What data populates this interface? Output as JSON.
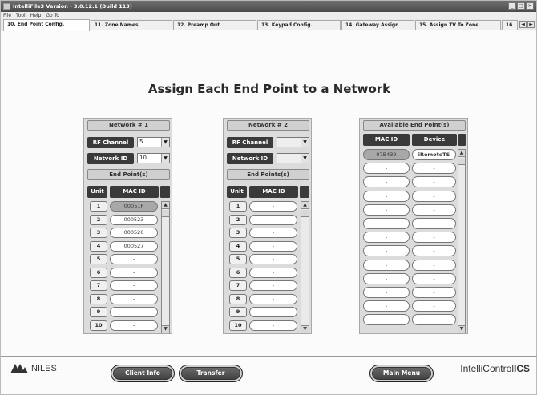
{
  "window": {
    "title": "IntelliFile3 Version - 3.0.12.1 (Build 113)",
    "controls": [
      "_",
      "□",
      "×"
    ]
  },
  "menu": [
    "File",
    "Tool",
    "Help",
    "Go To"
  ],
  "tabs": [
    {
      "label": "10. End Point Config.",
      "active": true
    },
    {
      "label": "11. Zone Names"
    },
    {
      "label": "12. Preamp Out"
    },
    {
      "label": "13. Keypad Config."
    },
    {
      "label": "14. Gateway Assign"
    },
    {
      "label": "15. Assign TV To Zone"
    },
    {
      "label": "16"
    }
  ],
  "tab_arrows": [
    "◄",
    "►"
  ],
  "page_title": "Assign Each End Point to a Network",
  "network1": {
    "title": "Network # 1",
    "rf_label": "RF Channel",
    "rf_value": "5",
    "netid_label": "Netvork ID",
    "netid_value": "10",
    "endpoints_label": "End Point(s)",
    "col_unit": "Unit",
    "col_mac": "MAC ID",
    "rows": [
      {
        "unit": "1",
        "mac": "00051F"
      },
      {
        "unit": "2",
        "mac": "000523"
      },
      {
        "unit": "3",
        "mac": "000526"
      },
      {
        "unit": "4",
        "mac": "000527"
      },
      {
        "unit": "5",
        "mac": "-"
      },
      {
        "unit": "6",
        "mac": "-"
      },
      {
        "unit": "7",
        "mac": "-"
      },
      {
        "unit": "8",
        "mac": "-"
      },
      {
        "unit": "9",
        "mac": "-"
      },
      {
        "unit": "10",
        "mac": "-"
      }
    ]
  },
  "network2": {
    "title": "Network # 2",
    "rf_label": "RF Channel",
    "rf_value": "",
    "netid_label": "Network ID",
    "netid_value": "",
    "endpoints_label": "End Points(s)",
    "col_unit": "Unit",
    "col_mac": "MAC ID",
    "rows": [
      {
        "unit": "1",
        "mac": "-"
      },
      {
        "unit": "2",
        "mac": "-"
      },
      {
        "unit": "3",
        "mac": "-"
      },
      {
        "unit": "4",
        "mac": "-"
      },
      {
        "unit": "5",
        "mac": "-"
      },
      {
        "unit": "6",
        "mac": "-"
      },
      {
        "unit": "7",
        "mac": "-"
      },
      {
        "unit": "8",
        "mac": "-"
      },
      {
        "unit": "9",
        "mac": "-"
      },
      {
        "unit": "10",
        "mac": "-"
      }
    ]
  },
  "available": {
    "title": "Available End Point(s)",
    "col_mac": "MAC ID",
    "col_device": "Device",
    "rows": [
      {
        "mac": "07B439",
        "device": "iRemoteTS"
      },
      {
        "mac": "-",
        "device": "-"
      },
      {
        "mac": "-",
        "device": "-"
      },
      {
        "mac": "-",
        "device": "-"
      },
      {
        "mac": "-",
        "device": "-"
      },
      {
        "mac": "-",
        "device": "-"
      },
      {
        "mac": "-",
        "device": "-"
      },
      {
        "mac": "-",
        "device": "-"
      },
      {
        "mac": "-",
        "device": "-"
      },
      {
        "mac": "-",
        "device": "-"
      },
      {
        "mac": "-",
        "device": "-"
      },
      {
        "mac": "-",
        "device": "-"
      },
      {
        "mac": "-",
        "device": "-"
      }
    ]
  },
  "scroll_arrows": {
    "up": "▲",
    "down": "▼"
  },
  "footer": {
    "logo_text": "NILES",
    "client_info": "Client Info",
    "transfer": "Transfer",
    "main_menu": "Main Menu",
    "brand_light": "IntelliControl",
    "brand_bold": "ICS"
  }
}
